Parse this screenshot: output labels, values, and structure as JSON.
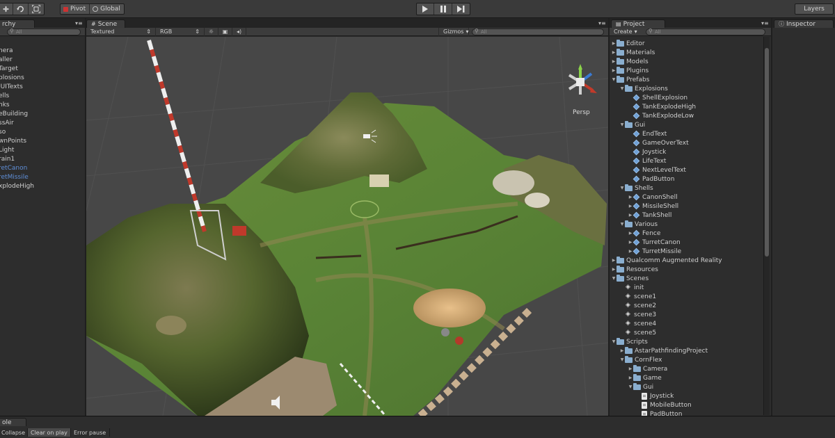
{
  "toolbar": {
    "pivot_label": "Pivot",
    "global_label": "Global",
    "layers_label": "Layers"
  },
  "hierarchy": {
    "tab_label": "rchy",
    "search_placeholder": "All",
    "items": [
      {
        "label": "nera",
        "color": "normal"
      },
      {
        "label": "aller",
        "color": "normal"
      },
      {
        "label": "Target",
        "color": "normal"
      },
      {
        "label": "plosions",
        "color": "normal"
      },
      {
        "label": "IUITexts",
        "color": "normal"
      },
      {
        "label": "ells",
        "color": "normal"
      },
      {
        "label": "nks",
        "color": "normal"
      },
      {
        "label": "eBuilding",
        "color": "normal"
      },
      {
        "label": "ssAir",
        "color": "normal"
      },
      {
        "label": "so",
        "color": "normal"
      },
      {
        "label": "wnPoints",
        "color": "normal"
      },
      {
        "label": "Light",
        "color": "normal"
      },
      {
        "label": "rain1",
        "color": "normal"
      },
      {
        "label": "retCanon",
        "color": "blue"
      },
      {
        "label": "retMissile",
        "color": "blue"
      },
      {
        "label": "xplodeHigh",
        "color": "normal"
      }
    ]
  },
  "scene": {
    "tab_label": "Scene",
    "render_mode": "Textured",
    "color_mode": "RGB",
    "gizmos_label": "Gizmos",
    "search_placeholder": "All",
    "persp_label": "Persp"
  },
  "project": {
    "tab_label": "Project",
    "create_label": "Create",
    "search_placeholder": "All",
    "tree": [
      {
        "label": "Editor",
        "type": "folder",
        "depth": 0,
        "expanded": false
      },
      {
        "label": "Materials",
        "type": "folder",
        "depth": 0,
        "expanded": false
      },
      {
        "label": "Models",
        "type": "folder",
        "depth": 0,
        "expanded": false
      },
      {
        "label": "Plugins",
        "type": "folder",
        "depth": 0,
        "expanded": false
      },
      {
        "label": "Prefabs",
        "type": "folder",
        "depth": 0,
        "expanded": true
      },
      {
        "label": "Explosions",
        "type": "folder",
        "depth": 1,
        "expanded": true
      },
      {
        "label": "ShellExplosion",
        "type": "prefab",
        "depth": 2
      },
      {
        "label": "TankExplodeHigh",
        "type": "prefab",
        "depth": 2
      },
      {
        "label": "TankExplodeLow",
        "type": "prefab",
        "depth": 2
      },
      {
        "label": "Gui",
        "type": "folder",
        "depth": 1,
        "expanded": true
      },
      {
        "label": "EndText",
        "type": "prefab",
        "depth": 2
      },
      {
        "label": "GameOverText",
        "type": "prefab",
        "depth": 2
      },
      {
        "label": "Joystick",
        "type": "prefab",
        "depth": 2
      },
      {
        "label": "LifeText",
        "type": "prefab",
        "depth": 2
      },
      {
        "label": "NextLevelText",
        "type": "prefab",
        "depth": 2
      },
      {
        "label": "PadButton",
        "type": "prefab",
        "depth": 2
      },
      {
        "label": "Shells",
        "type": "folder",
        "depth": 1,
        "expanded": true
      },
      {
        "label": "CanonShell",
        "type": "prefab",
        "depth": 2,
        "collapsible": true
      },
      {
        "label": "MissileShell",
        "type": "prefab",
        "depth": 2,
        "collapsible": true
      },
      {
        "label": "TankShell",
        "type": "prefab",
        "depth": 2,
        "collapsible": true
      },
      {
        "label": "Various",
        "type": "folder",
        "depth": 1,
        "expanded": true
      },
      {
        "label": "Fence",
        "type": "prefab",
        "depth": 2,
        "collapsible": true
      },
      {
        "label": "TurretCanon",
        "type": "prefab",
        "depth": 2,
        "collapsible": true
      },
      {
        "label": "TurretMissile",
        "type": "prefab",
        "depth": 2,
        "collapsible": true
      },
      {
        "label": "Qualcomm Augmented Reality",
        "type": "folder",
        "depth": 0,
        "expanded": false
      },
      {
        "label": "Resources",
        "type": "folder",
        "depth": 0,
        "expanded": false
      },
      {
        "label": "Scenes",
        "type": "folder",
        "depth": 0,
        "expanded": true
      },
      {
        "label": "init",
        "type": "scene",
        "depth": 1
      },
      {
        "label": "scene1",
        "type": "scene",
        "depth": 1
      },
      {
        "label": "scene2",
        "type": "scene",
        "depth": 1
      },
      {
        "label": "scene3",
        "type": "scene",
        "depth": 1
      },
      {
        "label": "scene4",
        "type": "scene",
        "depth": 1
      },
      {
        "label": "scene5",
        "type": "scene",
        "depth": 1
      },
      {
        "label": "Scripts",
        "type": "folder",
        "depth": 0,
        "expanded": true
      },
      {
        "label": "AstarPathfindingProject",
        "type": "folder",
        "depth": 1,
        "expanded": false
      },
      {
        "label": "CornFlex",
        "type": "folder",
        "depth": 1,
        "expanded": true
      },
      {
        "label": "Camera",
        "type": "folder",
        "depth": 2,
        "expanded": false
      },
      {
        "label": "Game",
        "type": "folder",
        "depth": 2,
        "expanded": false
      },
      {
        "label": "Gui",
        "type": "folder",
        "depth": 2,
        "expanded": true
      },
      {
        "label": "Joystick",
        "type": "script",
        "depth": 3
      },
      {
        "label": "MobileButton",
        "type": "script",
        "depth": 3
      },
      {
        "label": "PadButton",
        "type": "script",
        "depth": 3
      }
    ]
  },
  "inspector": {
    "tab_label": "Inspector"
  },
  "console": {
    "tab_label": "ole",
    "collapse_label": "Collapse",
    "clear_on_play_label": "Clear on play",
    "error_pause_label": "Error pause"
  }
}
